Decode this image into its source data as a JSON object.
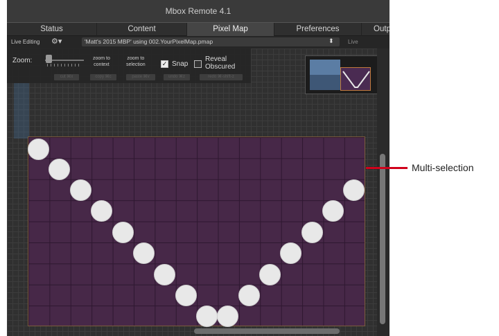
{
  "window": {
    "title": "Mbox Remote 4.1"
  },
  "tabs": [
    {
      "label": "Status"
    },
    {
      "label": "Content"
    },
    {
      "label": "Pixel Map"
    },
    {
      "label": "Preferences"
    },
    {
      "label": "Outp"
    }
  ],
  "livebar": {
    "live_editing_label": "Live Editing",
    "gear_icon": "gear-icon",
    "file_value": "'Matt's 2015 MBP' using 002.YourPixelMap.pmap",
    "stepper_glyph": "⬍",
    "live_label": "Live"
  },
  "toolbar": {
    "zoom_label": "Zoom:",
    "zoom_to_context": "zoom to\ncontext",
    "zoom_to_selection": "zoom to\nselection",
    "snap_label": "Snap",
    "snap_checked": true,
    "snap_mark": "✓",
    "reveal_label": "Reveal\nObscured",
    "reveal_checked": false,
    "small_buttons": [
      "cut ⌘x",
      "copy ⌘c",
      "paste ⌘v",
      "undo ⌘z",
      "redo ⌘-shift-z"
    ]
  },
  "annotation": {
    "text": "Multi-selection",
    "color": "#d0021b"
  },
  "colors": {
    "pixelmap_fill": "#472848",
    "dots": "#e8e8e8",
    "selection_border": "#7c5b3c"
  }
}
